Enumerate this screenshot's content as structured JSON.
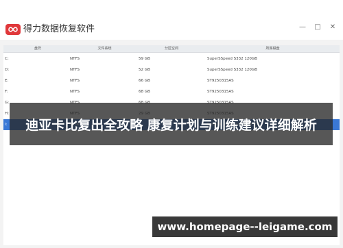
{
  "app": {
    "title": "得力数据恢复软件",
    "colors": {
      "brand": "#e0383b",
      "selection": "#3a78d6"
    }
  },
  "window_controls": [
    "minimize",
    "maximize",
    "close"
  ],
  "table": {
    "columns": [
      "盘符",
      "文件系统",
      "分区空间",
      "所属磁盘"
    ],
    "rows": [
      {
        "drive": "C:",
        "fs": "NTFS",
        "size": "59 GB",
        "disk": "SuperSSpeed S332 120GB",
        "selected": false
      },
      {
        "drive": "D:",
        "fs": "NTFS",
        "size": "52 GB",
        "disk": "SuperSSpeed S332 120GB",
        "selected": false
      },
      {
        "drive": "E:",
        "fs": "NTFS",
        "size": "66 GB",
        "disk": "ST9250315AS",
        "selected": false
      },
      {
        "drive": "F:",
        "fs": "NTFS",
        "size": "68 GB",
        "disk": "ST9250315AS",
        "selected": false
      },
      {
        "drive": "G:",
        "fs": "NTFS",
        "size": "68 GB",
        "disk": "ST9250315AS",
        "selected": false
      },
      {
        "drive": "H:",
        "fs": "NTFS",
        "size": "29 GB",
        "disk": "ST9250315AS",
        "selected": false
      },
      {
        "drive": "I:",
        "fs": "exFAT",
        "size": "",
        "disk": "Sandisk STORAGE DEVICE",
        "selected": true
      }
    ]
  },
  "overlay": {
    "headline": "迪亚卡比复出全攻略 康复计划与训练建议详细解析",
    "website": "www.homepage--leigame.com"
  }
}
